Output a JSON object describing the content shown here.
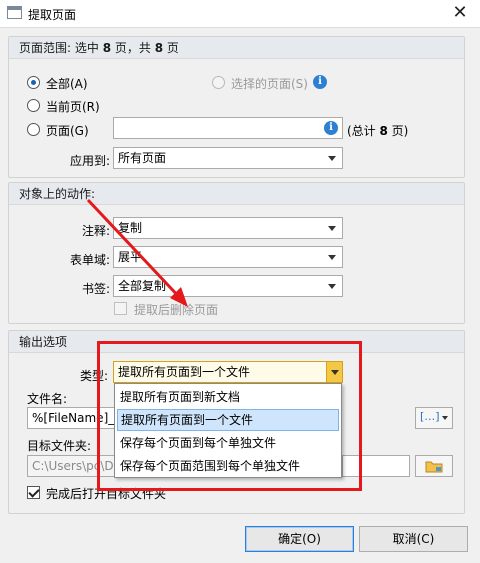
{
  "window": {
    "title": "提取页面",
    "close_glyph": "✕"
  },
  "page_range": {
    "header_prefix": "页面范围: 选中 ",
    "selected_count": "8",
    "header_mid": " 页，共 ",
    "total_count": "8",
    "header_suffix": " 页",
    "all_label": "全部(A)",
    "selected_label": "选择的页面(S)",
    "current_label": "当前页(R)",
    "pages_label": "页面(G)",
    "pages_value": "",
    "total_prefix": "(总计 ",
    "total_pages": "8",
    "total_suffix": " 页)",
    "apply_to_label": "应用到:",
    "apply_to_value": "所有页面"
  },
  "actions": {
    "header": "对象上的动作:",
    "annotation_label": "注释:",
    "annotation_value": "复制",
    "form_label": "表单域:",
    "form_value": "展平",
    "bookmark_label": "书签:",
    "bookmark_value": "全部复制",
    "delete_after_label": "提取后删除页面"
  },
  "output": {
    "header": "输出选项",
    "type_label": "类型:",
    "type_value": "提取所有页面到一个文件",
    "type_options": [
      "提取所有页面到新文档",
      "提取所有页面到一个文件",
      "保存每个页面到每个单独文件",
      "保存每个页面范围到每个单独文件"
    ],
    "filename_label": "文件名:",
    "filename_value": "%[FileName]_%",
    "folder_label": "目标文件夹:",
    "folder_value": "C:\\Users\\pc\\D",
    "open_folder_label": "完成后打开目标文件夹",
    "macro_glyph": "[…]"
  },
  "buttons": {
    "ok": "确定(O)",
    "cancel": "取消(C)"
  },
  "colors": {
    "highlight": "#e3191b",
    "accent": "#2d7fd3"
  }
}
